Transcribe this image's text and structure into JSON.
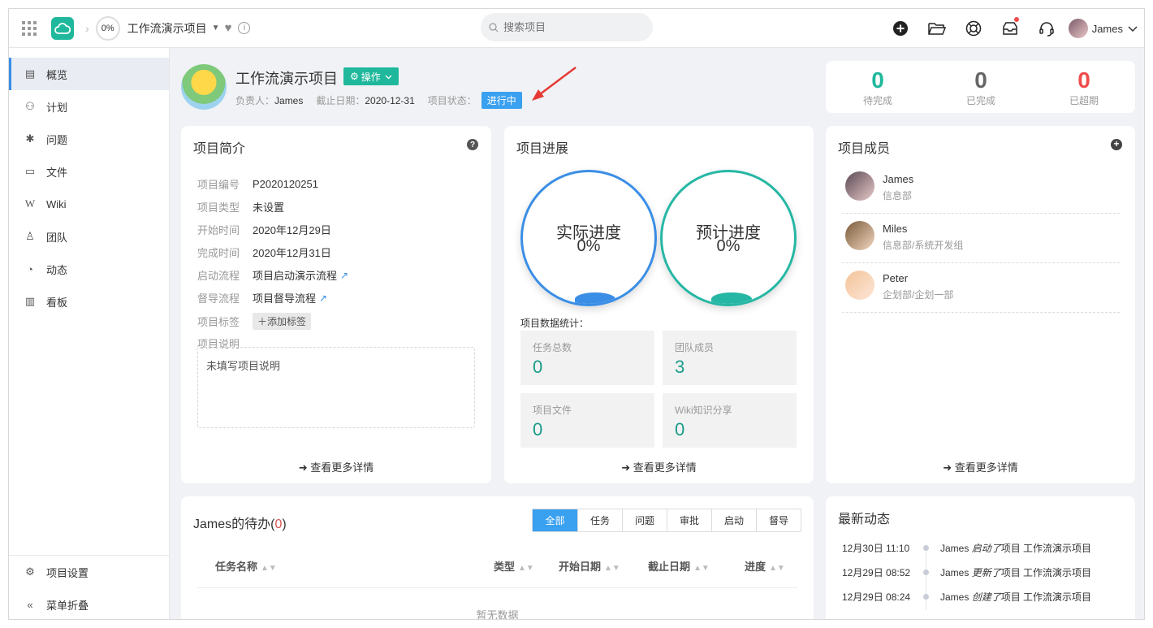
{
  "topbar": {
    "progress": "0%",
    "project_name": "工作流演示项目",
    "search_placeholder": "搜索项目",
    "user_name": "James"
  },
  "sidebar": {
    "items": [
      {
        "label": "概览",
        "icon": "overview-icon"
      },
      {
        "label": "计划",
        "icon": "plan-icon"
      },
      {
        "label": "问题",
        "icon": "bug-icon"
      },
      {
        "label": "文件",
        "icon": "folder-icon"
      },
      {
        "label": "Wiki",
        "icon": "wiki-icon"
      },
      {
        "label": "团队",
        "icon": "team-icon"
      },
      {
        "label": "动态",
        "icon": "activity-icon"
      },
      {
        "label": "看板",
        "icon": "board-icon"
      }
    ],
    "settings_label": "项目设置",
    "collapse_label": "菜单折叠"
  },
  "header": {
    "title": "工作流演示项目",
    "operate_label": "操作",
    "owner_label": "负责人：",
    "owner": "James",
    "deadline_label": "截止日期：",
    "deadline": "2020-12-31",
    "status_label": "项目状态：",
    "status": "进行中"
  },
  "stats": {
    "pending": {
      "value": "0",
      "label": "待完成",
      "color": "#1fb89c"
    },
    "done": {
      "value": "0",
      "label": "已完成",
      "color": "#666666"
    },
    "overdue": {
      "value": "0",
      "label": "已超期",
      "color": "#f04b4b"
    }
  },
  "intro": {
    "title": "项目简介",
    "fields": [
      {
        "key": "项目编号",
        "value": "P2020120251"
      },
      {
        "key": "项目类型",
        "value": "未设置"
      },
      {
        "key": "开始时间",
        "value": "2020年12月29日"
      },
      {
        "key": "完成时间",
        "value": "2020年12月31日"
      },
      {
        "key": "启动流程",
        "value": "项目启动演示流程"
      },
      {
        "key": "督导流程",
        "value": "项目督导流程"
      },
      {
        "key": "项目标签",
        "value": "添加标签"
      },
      {
        "key": "项目说明",
        "value": ""
      }
    ],
    "description": "未填写项目说明",
    "more": "查看更多详情"
  },
  "progress": {
    "title": "项目进展",
    "actual_label": "实际进度",
    "actual_value": "0%",
    "planned_label": "预计进度",
    "planned_value": "0%",
    "stats_label": "项目数据统计：",
    "boxes": [
      {
        "label": "任务总数",
        "value": "0"
      },
      {
        "label": "团队成员",
        "value": "3"
      },
      {
        "label": "项目文件",
        "value": "0"
      },
      {
        "label": "Wiki知识分享",
        "value": "0"
      }
    ],
    "more": "查看更多详情"
  },
  "members": {
    "title": "项目成员",
    "list": [
      {
        "name": "James",
        "dept": "信息部"
      },
      {
        "name": "Miles",
        "dept": "信息部/系统开发组"
      },
      {
        "name": "Peter",
        "dept": "企划部/企划一部"
      }
    ],
    "more": "查看更多详情"
  },
  "todo": {
    "title_prefix": "James的待办(",
    "count": "0",
    "title_suffix": ")",
    "tabs": [
      "全部",
      "任务",
      "问题",
      "审批",
      "启动",
      "督导"
    ],
    "columns": [
      "任务名称",
      "类型",
      "开始日期",
      "截止日期",
      "进度"
    ],
    "empty": "暂无数据"
  },
  "activity": {
    "title": "最新动态",
    "items": [
      {
        "time": "12月30日 11:10",
        "user": "James",
        "action": "启动了",
        "object": "项目 工作流演示项目"
      },
      {
        "time": "12月29日 08:52",
        "user": "James",
        "action": "更新了",
        "object": "项目 工作流演示项目"
      },
      {
        "time": "12月29日 08:24",
        "user": "James",
        "action": "创建了",
        "object": "项目 工作流演示项目"
      }
    ]
  }
}
